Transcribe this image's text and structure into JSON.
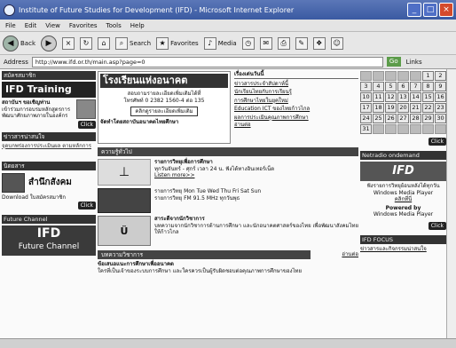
{
  "window": {
    "title": "Institute of Future Studies for Development (IFD) - Microsoft Internet Explorer",
    "controls": [
      "_",
      "□",
      "×"
    ]
  },
  "menu": [
    "File",
    "Edit",
    "View",
    "Favorites",
    "Tools",
    "Help"
  ],
  "toolbar": {
    "back": "Back",
    "search": "Search",
    "favorites": "Favorites",
    "media": "Media"
  },
  "address": {
    "label": "Address",
    "url": "http://www.ifd.or.th/main.asp?page=0",
    "go": "Go",
    "links": "Links"
  },
  "left": {
    "top_header": "สมัครสมาชิก",
    "ifd_training": "IFD Training",
    "training_title": "สถาบันฯ ขอเชิญท่าน",
    "training_desc": "เข้าร่วมการอบรมหลักสูตรการพัฒนาศักยภาพภายในองค์กร",
    "click": "Click",
    "qa_header": "ข่าวสารน่าสนใจ",
    "qa_text": "จุดบกพร่องการประเมินผล ตามหลักการ",
    "mag_header": "นิตยสาร",
    "mag_title": "สำนึกสังคม",
    "mag_download": "Download ใบสมัครสมาชิก",
    "fc_header": "Future Channel",
    "fc_logo": "IFD",
    "fc_sub": "Future Channel"
  },
  "middle": {
    "banner": "โรงเรียนแห่งอนาคต",
    "banner_text1": "สอบถามรายละเอียดเพิ่มเติมได้ที่",
    "banner_text2": "โทรศัพท์ 0 2382 1560-4 ต่อ 135",
    "banner_btn": "คลิกดูรายละเอียดเพิ่มเติม",
    "banner_note": "จัดทำโดยสถาบันอนาคตไทยศึกษา",
    "news_header": "เรื่องเด่นวันนี้",
    "news": [
      "ข่าวสารประจำสัปดาห์นี้",
      "นักเรียนไทยกับการเรียนรู้",
      "การศึกษาไทยในยุคใหม่",
      "Education ICT ของไทยก้าวไกล",
      "ผลการประเมินคุณภาพการศึกษา"
    ],
    "news_more": "อ่านต่อ",
    "feature_header": "ความรู้ทั่วไป",
    "radio_title": "รายการวิทยุเพื่อการศึกษา",
    "radio_text": "ทุกวันจันทร์ - ศุกร์ เวลา 24 น. ฟังได้ทางอินเทอร์เน็ต",
    "radio_listen": "Listen more>>",
    "radio2_text": "รายการวิทยุ Mon Tue Wed Thu Fri Sat Sun",
    "radio3_text": "รายการวิทยุ FM 91.5 MHz ทุกวันพุธ",
    "col_title": "สาระดีจากนักวิชาการ",
    "col_text": "บทความจากนักวิชาการด้านการศึกษา และนักอนาคตศาสตร์ของไทย เพื่อพัฒนาสังคมไทยให้ก้าวไกล",
    "bottom_header": "บทความวิชาการ",
    "bottom_more": "อ่านต่อ",
    "bottom_title": "ข้อเสนอแนะการศึกษาเพื่ออนาคต",
    "bottom_text": "ใครที่เป็นเจ้าของระบบการศึกษา และใครควรเป็นผู้รับผิดชอบต่อคุณภาพการศึกษาของไทย"
  },
  "right": {
    "calendar": [
      [
        "",
        "",
        "",
        "",
        "",
        "1",
        "2"
      ],
      [
        "3",
        "4",
        "5",
        "6",
        "7",
        "8",
        "9"
      ],
      [
        "10",
        "11",
        "12",
        "13",
        "14",
        "15",
        "16"
      ],
      [
        "17",
        "18",
        "19",
        "20",
        "21",
        "22",
        "23"
      ],
      [
        "24",
        "25",
        "26",
        "27",
        "28",
        "29",
        "30"
      ],
      [
        "31",
        "",
        "",
        "",
        "",
        "",
        ""
      ]
    ],
    "click": "Click",
    "radio_header": "Netradio ondemand",
    "radio_logo": "IFD",
    "radio_text1": "ฟังรายการวิทยุย้อนหลังได้ทุกวัน",
    "radio_text2": "Windows Media Player",
    "radio_text3": "คลิกที่นี่",
    "radio_powered": "Powered by",
    "radio_powered2": "Windows Media Player",
    "focus_header": "IFD FOCUS",
    "focus_item": "ข่าวสารและกิจกรรมน่าสนใจ"
  }
}
